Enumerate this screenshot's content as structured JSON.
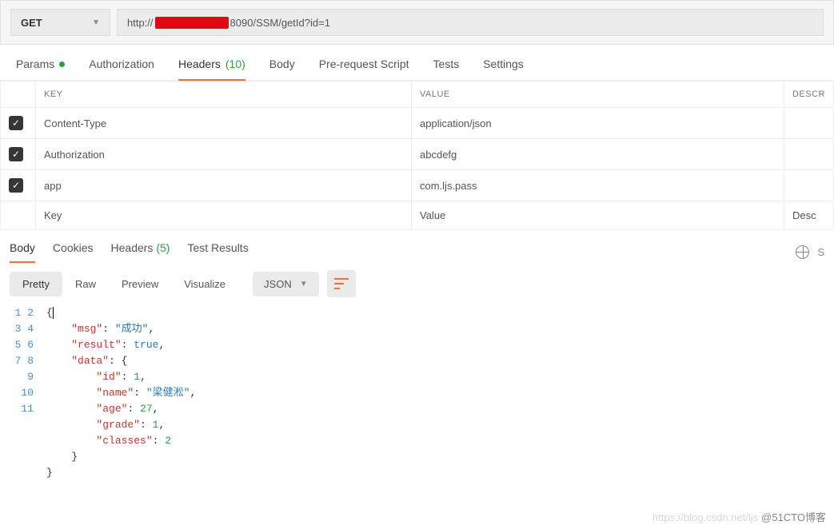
{
  "request": {
    "method": "GET",
    "url_prefix": "http://",
    "url_suffix": "8090/SSM/getId?id=1"
  },
  "reqTabs": {
    "params": "Params",
    "authorization": "Authorization",
    "headers": "Headers",
    "headers_count": "(10)",
    "body": "Body",
    "prereq": "Pre-request Script",
    "tests": "Tests",
    "settings": "Settings"
  },
  "headersTable": {
    "colKey": "KEY",
    "colValue": "VALUE",
    "colDesc": "DESCR",
    "rows": [
      {
        "key": "Content-Type",
        "value": "application/json"
      },
      {
        "key": "Authorization",
        "value": "abcdefg"
      },
      {
        "key": "app",
        "value": "com.ljs.pass"
      }
    ],
    "placeholderKey": "Key",
    "placeholderValue": "Value",
    "placeholderDesc": "Desc"
  },
  "respTabs": {
    "body": "Body",
    "cookies": "Cookies",
    "headers": "Headers",
    "headers_count": "(5)",
    "test": "Test Results",
    "rightS": "S"
  },
  "prettyBar": {
    "pretty": "Pretty",
    "raw": "Raw",
    "preview": "Preview",
    "visualize": "Visualize",
    "format": "JSON"
  },
  "responseJson": {
    "lines": [
      "1",
      "2",
      "3",
      "4",
      "5",
      "6",
      "7",
      "8",
      "9",
      "10",
      "11"
    ],
    "tokens": [
      [
        {
          "t": "{",
          "c": ""
        }
      ],
      [
        {
          "t": "    ",
          "c": ""
        },
        {
          "t": "\"msg\"",
          "c": "k-red"
        },
        {
          "t": ": ",
          "c": ""
        },
        {
          "t": "\"成功\"",
          "c": "k-blue"
        },
        {
          "t": ",",
          "c": ""
        }
      ],
      [
        {
          "t": "    ",
          "c": ""
        },
        {
          "t": "\"result\"",
          "c": "k-red"
        },
        {
          "t": ": ",
          "c": ""
        },
        {
          "t": "true",
          "c": "k-blue"
        },
        {
          "t": ",",
          "c": ""
        }
      ],
      [
        {
          "t": "    ",
          "c": ""
        },
        {
          "t": "\"data\"",
          "c": "k-red"
        },
        {
          "t": ": {",
          "c": ""
        }
      ],
      [
        {
          "t": "        ",
          "c": ""
        },
        {
          "t": "\"id\"",
          "c": "k-red"
        },
        {
          "t": ": ",
          "c": ""
        },
        {
          "t": "1",
          "c": "k-green"
        },
        {
          "t": ",",
          "c": ""
        }
      ],
      [
        {
          "t": "        ",
          "c": ""
        },
        {
          "t": "\"name\"",
          "c": "k-red"
        },
        {
          "t": ": ",
          "c": ""
        },
        {
          "t": "\"梁健淞\"",
          "c": "k-blue"
        },
        {
          "t": ",",
          "c": ""
        }
      ],
      [
        {
          "t": "        ",
          "c": ""
        },
        {
          "t": "\"age\"",
          "c": "k-red"
        },
        {
          "t": ": ",
          "c": ""
        },
        {
          "t": "27",
          "c": "k-green"
        },
        {
          "t": ",",
          "c": ""
        }
      ],
      [
        {
          "t": "        ",
          "c": ""
        },
        {
          "t": "\"grade\"",
          "c": "k-red"
        },
        {
          "t": ": ",
          "c": ""
        },
        {
          "t": "1",
          "c": "k-green"
        },
        {
          "t": ",",
          "c": ""
        }
      ],
      [
        {
          "t": "        ",
          "c": ""
        },
        {
          "t": "\"classes\"",
          "c": "k-red"
        },
        {
          "t": ": ",
          "c": ""
        },
        {
          "t": "2",
          "c": "k-green"
        }
      ],
      [
        {
          "t": "    }",
          "c": ""
        }
      ],
      [
        {
          "t": "}",
          "c": ""
        }
      ]
    ]
  },
  "watermark": {
    "faint": "https://blog.csdn.net/ljs",
    "dark": "@51CTO博客"
  }
}
